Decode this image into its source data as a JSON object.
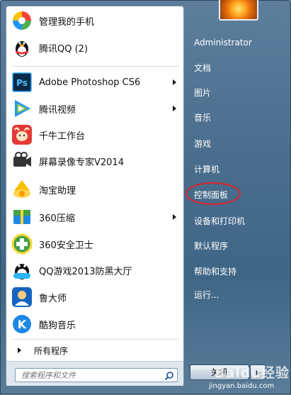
{
  "left_pane": {
    "programs": [
      {
        "label": "管理我的手机",
        "icon": "phone-manager-icon",
        "has_arrow": false
      },
      {
        "label": "腾讯QQ (2)",
        "icon": "qq-penguin-icon",
        "has_arrow": false
      },
      {
        "label": "Adobe Photoshop CS6",
        "icon": "photoshop-icon",
        "has_arrow": true
      },
      {
        "label": "腾讯视频",
        "icon": "tencent-video-icon",
        "has_arrow": true
      },
      {
        "label": "千牛工作台",
        "icon": "qianniu-icon",
        "has_arrow": false
      },
      {
        "label": "屏幕录像专家V2014",
        "icon": "screen-recorder-icon",
        "has_arrow": false
      },
      {
        "label": "淘宝助理",
        "icon": "taobao-assistant-icon",
        "has_arrow": false
      },
      {
        "label": "360压缩",
        "icon": "360-zip-icon",
        "has_arrow": true
      },
      {
        "label": "360安全卫士",
        "icon": "360-safe-icon",
        "has_arrow": false
      },
      {
        "label": "QQ游戏2013防黑大厅",
        "icon": "qq-game-icon",
        "has_arrow": false
      },
      {
        "label": "鲁大师",
        "icon": "ludashi-icon",
        "has_arrow": false
      },
      {
        "label": "酷狗音乐",
        "icon": "kugou-icon",
        "has_arrow": false
      }
    ],
    "all_programs_label": "所有程序",
    "search_placeholder": "搜索程序和文件"
  },
  "right_pane": {
    "user_name": "Administrator",
    "items": [
      {
        "label": "文档"
      },
      {
        "label": "图片"
      },
      {
        "label": "音乐"
      },
      {
        "label": "游戏"
      },
      {
        "label": "计算机"
      },
      {
        "label": "控制面板",
        "highlighted": true
      },
      {
        "label": "设备和打印机"
      },
      {
        "label": "默认程序"
      },
      {
        "label": "帮助和支持"
      },
      {
        "label": "运行..."
      }
    ],
    "shutdown_label": "关机"
  },
  "watermark": {
    "brand": "Baidu经验",
    "url": "jingyan.baidu.com"
  },
  "colors": {
    "highlight_ring": "#e0232b",
    "menu_blue": "#4a6d8d"
  }
}
